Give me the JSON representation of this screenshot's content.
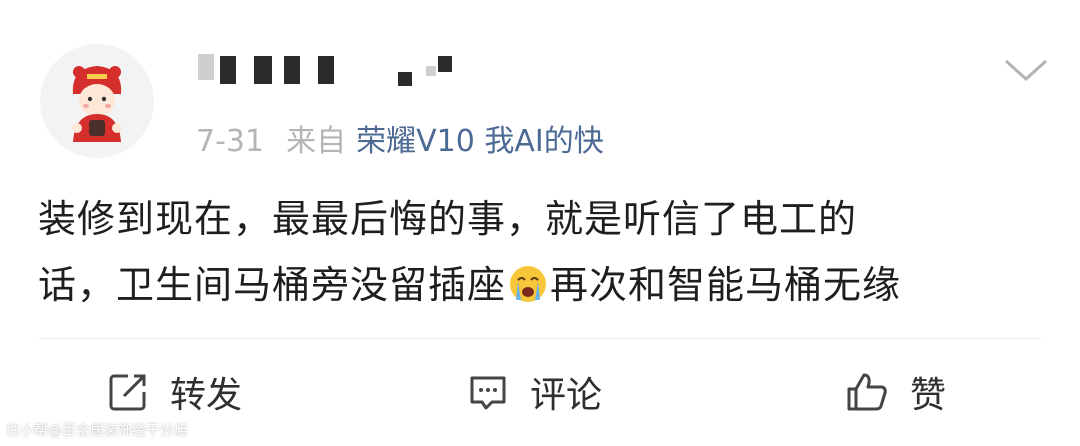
{
  "post": {
    "author": {
      "name": "",
      "avatar_icon": "avatar-illustration"
    },
    "meta": {
      "date": "7-31",
      "from_label": "来自",
      "source": "荣耀V10 我AI的快"
    },
    "content": {
      "line1": "装修到现在，最最后悔的事，就是听信了电工的",
      "line2a": "话，卫生间马桶旁没留插座",
      "emoji": "crying-face-emoji",
      "line2b": "再次和智能马桶无缘"
    },
    "actions": {
      "repost_label": "转发",
      "comment_label": "评论",
      "like_label": "赞"
    }
  },
  "watermark": "住小帮@百合居装饰经干分店",
  "colors": {
    "source_link": "#4d6a95",
    "text": "#1e1e1e",
    "muted": "#8c8c8c"
  }
}
